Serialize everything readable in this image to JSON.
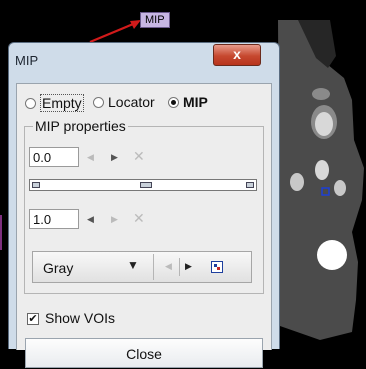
{
  "tooltip": {
    "label": "MIP"
  },
  "dialog": {
    "title": "MIP",
    "close_x": "x",
    "mode_options": [
      {
        "label": "Empty",
        "selected": false
      },
      {
        "label": "Locator",
        "selected": false
      },
      {
        "label": "MIP",
        "selected": true
      }
    ],
    "mip_properties": {
      "legend": "MIP properties",
      "lower_value": "0.0",
      "upper_value": "1.0",
      "colormap": "Gray"
    },
    "show_vois": {
      "label": "Show VOIs",
      "checked": true
    },
    "close_button": "Close"
  },
  "colors": {
    "dialog_frame": "#cfdce9",
    "close_red": "#c6482f",
    "arrow_red": "#d11a1a",
    "voi_marker": "#1d3fd6"
  },
  "icons": [
    "close-icon",
    "triangle-left-icon",
    "triangle-right-icon",
    "clear-x-icon",
    "dropdown-caret-icon",
    "color-table-icon",
    "checkmark-icon"
  ]
}
